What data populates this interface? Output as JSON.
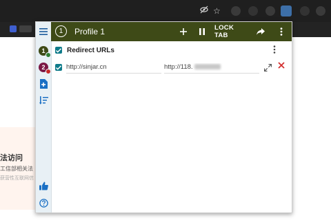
{
  "popup": {
    "profile_index": "1",
    "profile_name": "Profile 1",
    "lock_tab_label": "LOCK TAB",
    "colors": {
      "header": "#3e4a17",
      "accent": "#0f7b8a",
      "delete": "#d32f2f"
    },
    "sidebar": {
      "profiles": [
        {
          "label": "1",
          "color": "#3e4a17",
          "dot_color": "#2e7d32"
        },
        {
          "label": "2",
          "color": "#7b1845",
          "dot_color": "#c62828"
        }
      ],
      "icons": [
        "menu-icon",
        "new-file-icon",
        "sort-icon",
        "thumbs-up-icon",
        "help-icon"
      ]
    },
    "group": {
      "title": "Redirect URLs",
      "enabled": true,
      "rule": {
        "enabled": true,
        "from": "http://sinjar.cn",
        "to": "http://118."
      }
    }
  },
  "background_page": {
    "title": "法访问",
    "line1": "工信部相关法",
    "line2": "获营性互联网信"
  }
}
